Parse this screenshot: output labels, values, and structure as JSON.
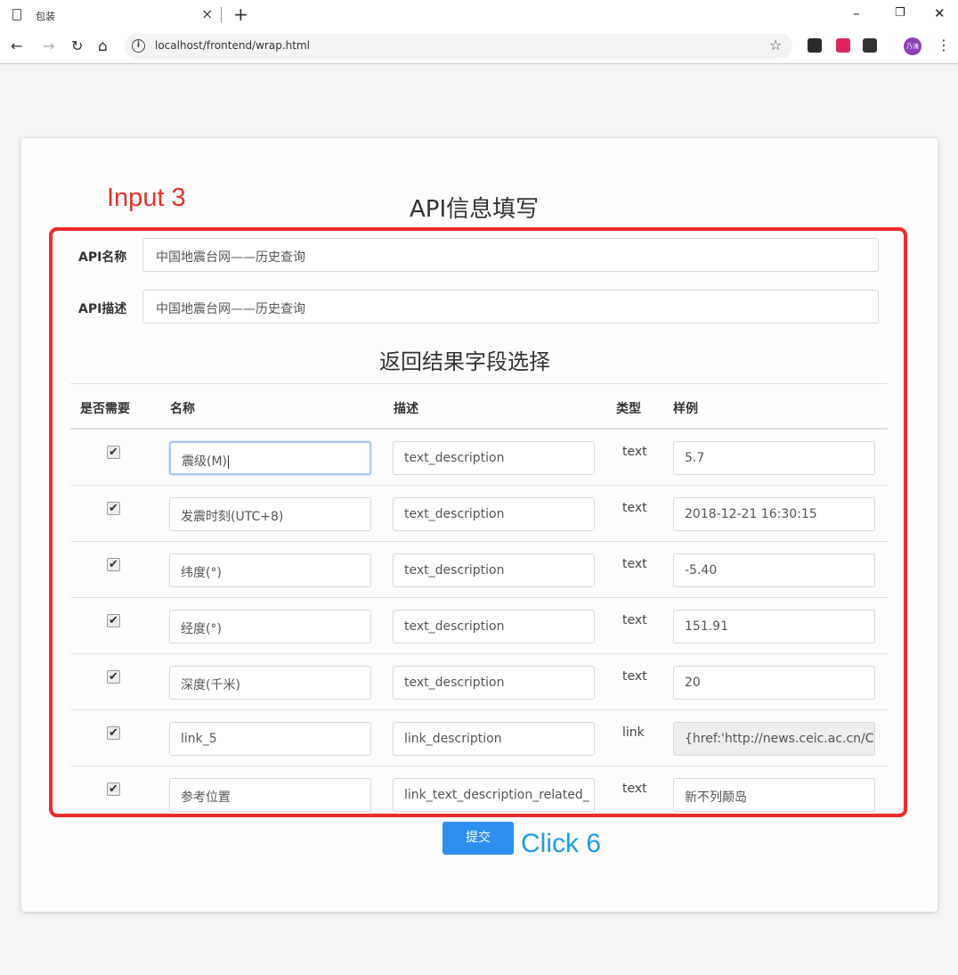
{
  "browser": {
    "tab_title": "包装",
    "url": "localhost/frontend/wrap.html",
    "profile_initials": "乃涛"
  },
  "annotations": {
    "input_label": "Input 3",
    "click_label": "Click 6"
  },
  "page": {
    "title": "API信息填写",
    "api_name_label": "API名称",
    "api_name_value": "中国地震台网——历史查询",
    "api_desc_label": "API描述",
    "api_desc_value": "中国地震台网——历史查询",
    "section_title": "返回结果字段选择",
    "columns": [
      "是否需要",
      "名称",
      "描述",
      "类型",
      "样例"
    ],
    "rows": [
      {
        "checked": true,
        "name": "震级(M)",
        "desc": "text_description",
        "type": "text",
        "sample": "5.7"
      },
      {
        "checked": true,
        "name": "发震时刻(UTC+8)",
        "desc": "text_description",
        "type": "text",
        "sample": "2018-12-21 16:30:15"
      },
      {
        "checked": true,
        "name": "纬度(°)",
        "desc": "text_description",
        "type": "text",
        "sample": "-5.40"
      },
      {
        "checked": true,
        "name": "经度(°)",
        "desc": "text_description",
        "type": "text",
        "sample": "151.91"
      },
      {
        "checked": true,
        "name": "深度(千米)",
        "desc": "text_description",
        "type": "text",
        "sample": "20"
      },
      {
        "checked": true,
        "name": "link_5",
        "desc": "link_description",
        "type": "link",
        "sample": "{href:'http://news.ceic.ac.cn/C"
      },
      {
        "checked": true,
        "name": "参考位置",
        "desc": "link_text_description_related_",
        "type": "text",
        "sample": "新不列颠岛"
      }
    ],
    "submit_label": "提交"
  },
  "colors": {
    "annotation_red": "#ee2b2b",
    "annotation_blue": "#1a9fe0",
    "primary_button": "#2d8ff0"
  }
}
